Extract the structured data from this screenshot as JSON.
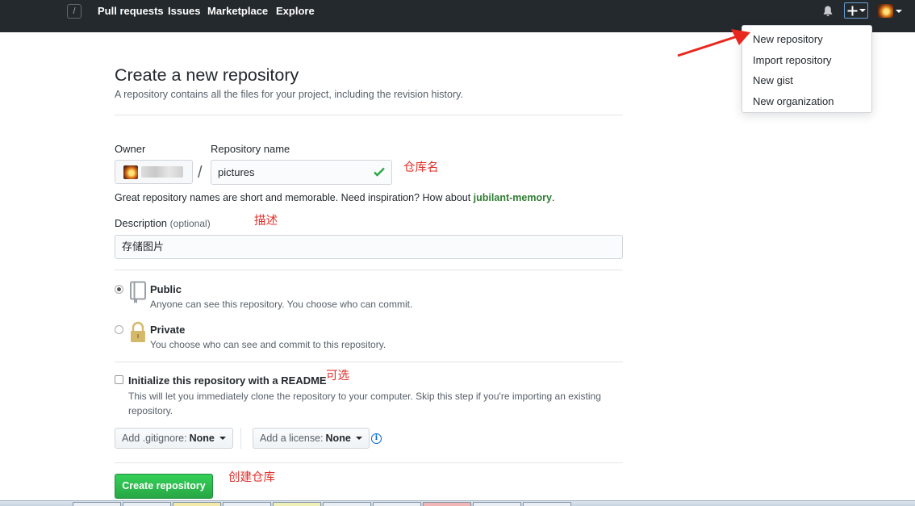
{
  "header": {
    "slash_key": "/",
    "nav": [
      "Pull requests",
      "Issues",
      "Marketplace",
      "Explore"
    ]
  },
  "dropdown": {
    "items": [
      "New repository",
      "Import repository",
      "New gist",
      "New organization"
    ]
  },
  "page": {
    "title": "Create a new repository",
    "subtitle": "A repository contains all the files for your project, including the revision history."
  },
  "form": {
    "owner_label": "Owner",
    "repo_label": "Repository name",
    "separator": "/",
    "repo_value": "pictures",
    "hint_prefix": "Great repository names are short and memorable. Need inspiration? How about ",
    "hint_suggestion": "jubilant-memory",
    "hint_suffix": ".",
    "description_label": "Description",
    "description_optional": "(optional)",
    "description_value": "存储图片",
    "public_title": "Public",
    "public_desc": "Anyone can see this repository. You choose who can commit.",
    "private_title": "Private",
    "private_desc": "You choose who can see and commit to this repository.",
    "init_title": "Initialize this repository with a README",
    "init_desc": "This will let you immediately clone the repository to your computer. Skip this step if you're importing an existing repository.",
    "gitignore_label": "Add .gitignore:",
    "gitignore_value": "None",
    "license_label": "Add a license:",
    "license_value": "None",
    "info_glyph": "i",
    "create_button": "Create repository",
    "visibility_selected": "public",
    "readme_checked": false
  },
  "annotations": {
    "repo_name": "仓库名",
    "description": "描述",
    "optional": "可选",
    "create": "创建仓库"
  },
  "colors": {
    "header_bg": "#24292e",
    "create_green": "#28a745",
    "annotation_red": "#e0302a",
    "link_blue": "#0366d6"
  }
}
